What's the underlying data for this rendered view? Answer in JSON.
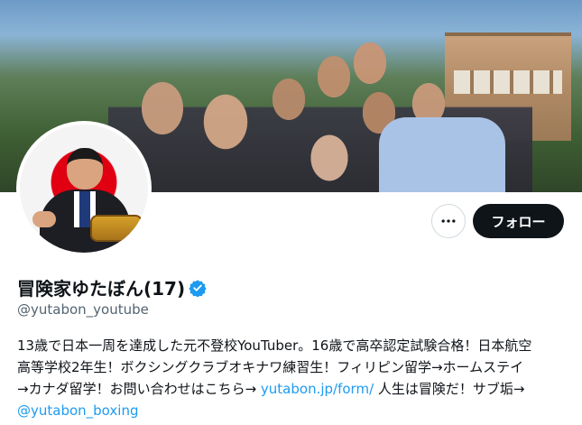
{
  "profile": {
    "display_name": "冒険家ゆたぼん(17)",
    "handle": "@yutabon_youtube",
    "verified": true
  },
  "actions": {
    "more_icon": "more-horizontal-icon",
    "follow_label": "フォロー"
  },
  "bio": {
    "line1": "13歳で日本一周を達成した元不登校YouTuber。16歳で高卒認定試験合格！日本航空",
    "line2": "高等学校2年生！ボクシングクラブオキナワ練習生！フィリピン留学→ホームステイ",
    "line3_text": "→カナダ留学！お問い合わせはこちら→ ",
    "line3_link": "yutabon.jp/form/",
    "line3_tail": " 人生は冒険だ！サブ垢→",
    "line4_link": "@yutabon_boxing"
  },
  "colors": {
    "accent": "#1d9bf0",
    "button_dark": "#0f1419",
    "muted": "#536471"
  }
}
